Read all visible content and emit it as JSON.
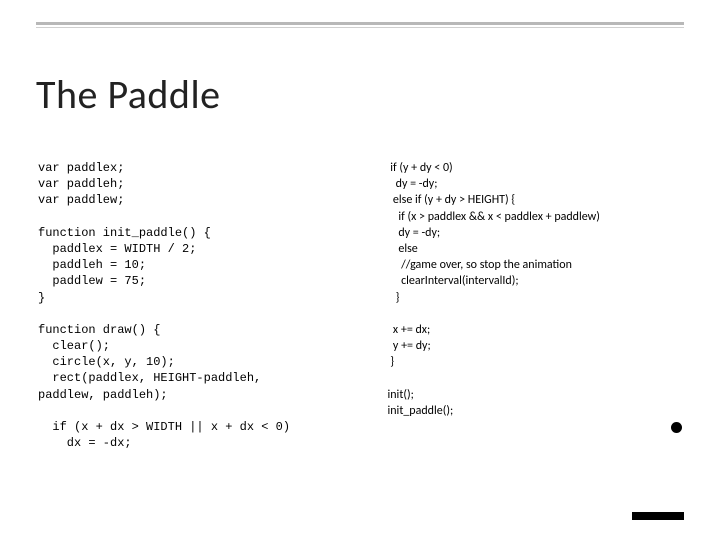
{
  "title": "The Paddle",
  "left_code": "var paddlex;\nvar paddleh;\nvar paddlew;\n\nfunction init_paddle() {\n  paddlex = WIDTH / 2;\n  paddleh = 10;\n  paddlew = 75;\n}\n\nfunction draw() {\n  clear();\n  circle(x, y, 10);\n  rect(paddlex, HEIGHT-paddleh,\npaddlew, paddleh);\n\n  if (x + dx > WIDTH || x + dx < 0)\n    dx = -dx;",
  "right_code": " if (y + dy < 0)\n   dy = -dy;\n  else if (y + dy > HEIGHT) {\n    if (x > paddlex && x < paddlex + paddlew)\n    dy = -dy;\n    else\n     //game over, so stop the animation\n     clearInterval(intervalId);\n   }\n\n  x += dx;\n  y += dy;\n }\n\ninit();\ninit_paddle();"
}
